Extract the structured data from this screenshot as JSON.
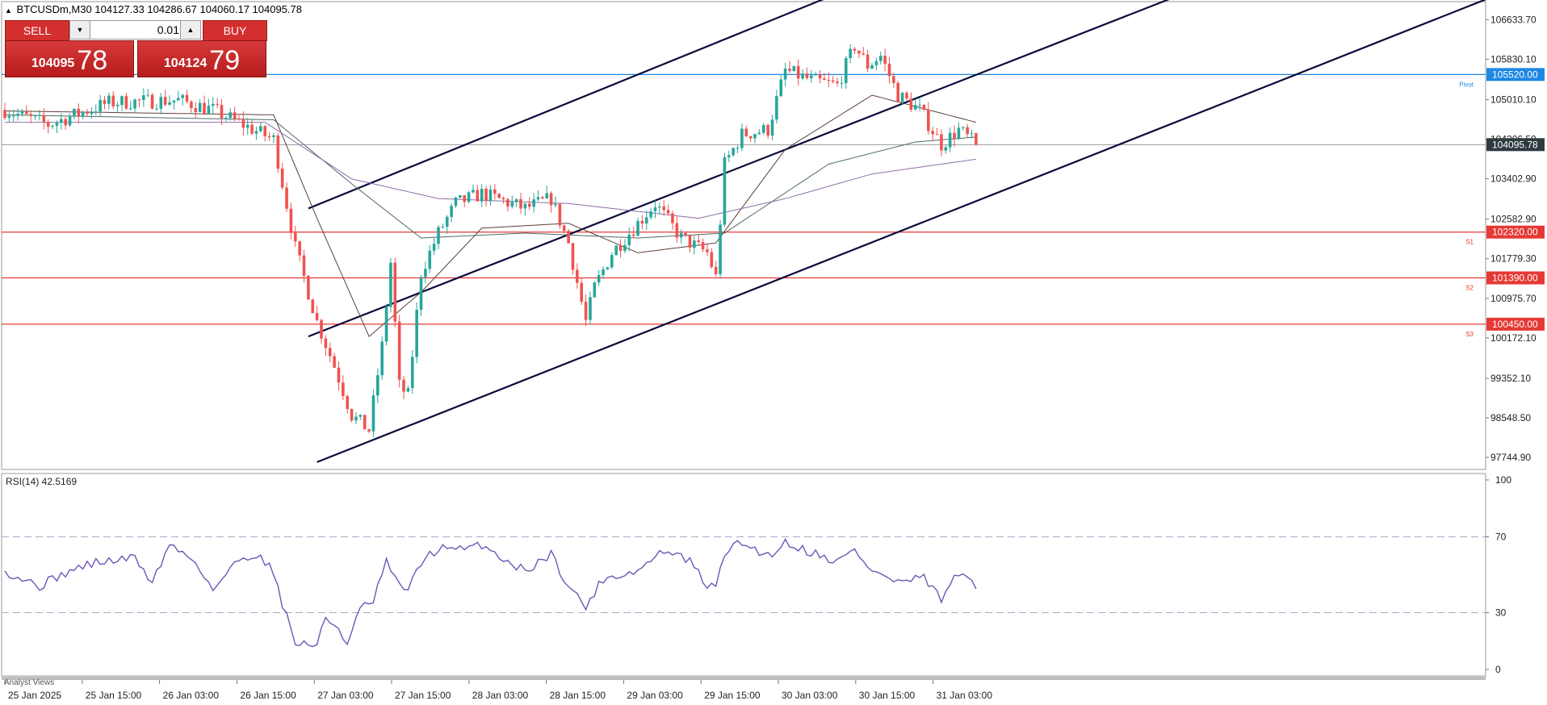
{
  "header": {
    "symbol_title": "BTCUSDm,M30",
    "ohlc": "104127.33 104286.67 104060.17 104095.78"
  },
  "trade_panel": {
    "sell_label": "SELL",
    "buy_label": "BUY",
    "lot_value": "0.01",
    "sell_price_main": "104095",
    "sell_price_big": "78",
    "buy_price_main": "104124",
    "buy_price_big": "79"
  },
  "bottom_tab": "Analyst Views",
  "colors": {
    "bull": "#26a69a",
    "bear": "#ef5350",
    "channel": "#0a0a3c",
    "pivot": "#1e88e5",
    "support": "#e53935",
    "rsi": "#6f55b5",
    "ma1": "#5d4037",
    "ma2": "#4f6b66",
    "ma3": "#8e6fa8"
  },
  "chart_data": [
    {
      "type": "candlestick",
      "series_name": "BTCUSDm,M30",
      "ylim": [
        97500,
        107000
      ],
      "y_ticks": [
        "106633.70",
        "105830.10",
        "105010.10",
        "104206.50",
        "103402.90",
        "102582.90",
        "101779.30",
        "100975.70",
        "100172.10",
        "99352.10",
        "98548.50",
        "97744.90"
      ],
      "x_ticks": [
        "25 Jan 2025",
        "25 Jan 15:00",
        "26 Jan 03:00",
        "26 Jan 15:00",
        "27 Jan 03:00",
        "27 Jan 15:00",
        "28 Jan 03:00",
        "28 Jan 15:00",
        "29 Jan 03:00",
        "29 Jan 15:00",
        "30 Jan 03:00",
        "30 Jan 15:00",
        "31 Jan 03:00"
      ],
      "price_anchors": [
        {
          "t": 0,
          "p": 104800
        },
        {
          "t": 10,
          "p": 104500
        },
        {
          "t": 24,
          "p": 104950
        },
        {
          "t": 40,
          "p": 105000
        },
        {
          "t": 48,
          "p": 104800
        },
        {
          "t": 55,
          "p": 104500
        },
        {
          "t": 62,
          "p": 104200
        },
        {
          "t": 67,
          "p": 102000
        },
        {
          "t": 72,
          "p": 100500
        },
        {
          "t": 76,
          "p": 99600
        },
        {
          "t": 80,
          "p": 98600
        },
        {
          "t": 84,
          "p": 98300
        },
        {
          "t": 87,
          "p": 100000
        },
        {
          "t": 89,
          "p": 101700
        },
        {
          "t": 91,
          "p": 99200
        },
        {
          "t": 93,
          "p": 99000
        },
        {
          "t": 96,
          "p": 101500
        },
        {
          "t": 100,
          "p": 102300
        },
        {
          "t": 104,
          "p": 102900
        },
        {
          "t": 110,
          "p": 103100
        },
        {
          "t": 120,
          "p": 102800
        },
        {
          "t": 126,
          "p": 103000
        },
        {
          "t": 130,
          "p": 102100
        },
        {
          "t": 134,
          "p": 100500
        },
        {
          "t": 136,
          "p": 101200
        },
        {
          "t": 140,
          "p": 101900
        },
        {
          "t": 146,
          "p": 102500
        },
        {
          "t": 150,
          "p": 102900
        },
        {
          "t": 156,
          "p": 102200
        },
        {
          "t": 162,
          "p": 101900
        },
        {
          "t": 164,
          "p": 101400
        },
        {
          "t": 166,
          "p": 103700
        },
        {
          "t": 170,
          "p": 104300
        },
        {
          "t": 176,
          "p": 104400
        },
        {
          "t": 180,
          "p": 105600
        },
        {
          "t": 186,
          "p": 105400
        },
        {
          "t": 192,
          "p": 105300
        },
        {
          "t": 196,
          "p": 106100
        },
        {
          "t": 199,
          "p": 105700
        },
        {
          "t": 202,
          "p": 105900
        },
        {
          "t": 206,
          "p": 105100
        },
        {
          "t": 211,
          "p": 104800
        },
        {
          "t": 216,
          "p": 104100
        },
        {
          "t": 220,
          "p": 104400
        },
        {
          "t": 224,
          "p": 104095
        }
      ],
      "candle_count": 225,
      "moving_averages": [
        {
          "anchors": [
            {
              "t": 0,
              "p": 104780
            },
            {
              "t": 62,
              "p": 104700
            },
            {
              "t": 72,
              "p": 102600
            },
            {
              "t": 84,
              "p": 100200
            },
            {
              "t": 96,
              "p": 101100
            },
            {
              "t": 110,
              "p": 102400
            },
            {
              "t": 130,
              "p": 102500
            },
            {
              "t": 146,
              "p": 101900
            },
            {
              "t": 164,
              "p": 102100
            },
            {
              "t": 180,
              "p": 104000
            },
            {
              "t": 200,
              "p": 105100
            },
            {
              "t": 224,
              "p": 104550
            }
          ]
        },
        {
          "anchors": [
            {
              "t": 0,
              "p": 104700
            },
            {
              "t": 62,
              "p": 104600
            },
            {
              "t": 80,
              "p": 103300
            },
            {
              "t": 96,
              "p": 102200
            },
            {
              "t": 120,
              "p": 102300
            },
            {
              "t": 146,
              "p": 102200
            },
            {
              "t": 166,
              "p": 102300
            },
            {
              "t": 190,
              "p": 103700
            },
            {
              "t": 210,
              "p": 104150
            },
            {
              "t": 224,
              "p": 104250
            }
          ]
        },
        {
          "anchors": [
            {
              "t": 0,
              "p": 104550
            },
            {
              "t": 60,
              "p": 104550
            },
            {
              "t": 80,
              "p": 103400
            },
            {
              "t": 100,
              "p": 103000
            },
            {
              "t": 130,
              "p": 102900
            },
            {
              "t": 160,
              "p": 102600
            },
            {
              "t": 180,
              "p": 103000
            },
            {
              "t": 200,
              "p": 103500
            },
            {
              "t": 224,
              "p": 103800
            }
          ]
        }
      ],
      "channel_lines": [
        {
          "start": {
            "t": 70,
            "p": 102800
          },
          "end": {
            "t": 193,
            "p": 107200
          }
        },
        {
          "start": {
            "t": 70,
            "p": 100200
          },
          "end": {
            "t": 270,
            "p": 107100
          }
        },
        {
          "start": {
            "t": 72,
            "p": 97650
          },
          "end": {
            "t": 346,
            "p": 107200
          }
        }
      ],
      "levels": [
        {
          "label": "Pivot",
          "price": 105520,
          "price_label": "105520.00",
          "color": "#1e88e5"
        },
        {
          "label": "S1",
          "price": 102320,
          "price_label": "102320.00",
          "color": "#e53935"
        },
        {
          "label": "S2",
          "price": 101390,
          "price_label": "101390.00",
          "color": "#e53935"
        },
        {
          "label": "S3",
          "price": 100450,
          "price_label": "100450.00",
          "color": "#e53935"
        }
      ],
      "current_price": 104095.78,
      "current_price_label": "104095.78"
    },
    {
      "type": "line",
      "title": "RSI(14) 42.5169",
      "ylim": [
        0,
        100
      ],
      "y_ticks": [
        100,
        70,
        30,
        0
      ],
      "levels": [
        70,
        30
      ],
      "anchors": [
        {
          "t": 0,
          "p": 52
        },
        {
          "t": 8,
          "p": 44
        },
        {
          "t": 14,
          "p": 51
        },
        {
          "t": 20,
          "p": 56
        },
        {
          "t": 30,
          "p": 59
        },
        {
          "t": 34,
          "p": 46
        },
        {
          "t": 38,
          "p": 66
        },
        {
          "t": 44,
          "p": 57
        },
        {
          "t": 48,
          "p": 42
        },
        {
          "t": 54,
          "p": 58
        },
        {
          "t": 58,
          "p": 61
        },
        {
          "t": 62,
          "p": 52
        },
        {
          "t": 64,
          "p": 35
        },
        {
          "t": 67,
          "p": 14
        },
        {
          "t": 72,
          "p": 13
        },
        {
          "t": 74,
          "p": 27
        },
        {
          "t": 77,
          "p": 22
        },
        {
          "t": 79,
          "p": 13
        },
        {
          "t": 82,
          "p": 32
        },
        {
          "t": 85,
          "p": 36
        },
        {
          "t": 88,
          "p": 57
        },
        {
          "t": 90,
          "p": 47
        },
        {
          "t": 93,
          "p": 42
        },
        {
          "t": 97,
          "p": 60
        },
        {
          "t": 101,
          "p": 64
        },
        {
          "t": 106,
          "p": 63
        },
        {
          "t": 110,
          "p": 66
        },
        {
          "t": 116,
          "p": 57
        },
        {
          "t": 120,
          "p": 52
        },
        {
          "t": 126,
          "p": 61
        },
        {
          "t": 130,
          "p": 44
        },
        {
          "t": 134,
          "p": 33
        },
        {
          "t": 138,
          "p": 48
        },
        {
          "t": 146,
          "p": 52
        },
        {
          "t": 152,
          "p": 63
        },
        {
          "t": 158,
          "p": 57
        },
        {
          "t": 162,
          "p": 44
        },
        {
          "t": 164,
          "p": 43
        },
        {
          "t": 166,
          "p": 62
        },
        {
          "t": 170,
          "p": 67
        },
        {
          "t": 176,
          "p": 60
        },
        {
          "t": 180,
          "p": 67
        },
        {
          "t": 186,
          "p": 62
        },
        {
          "t": 192,
          "p": 57
        },
        {
          "t": 196,
          "p": 63
        },
        {
          "t": 200,
          "p": 52
        },
        {
          "t": 206,
          "p": 46
        },
        {
          "t": 212,
          "p": 48
        },
        {
          "t": 216,
          "p": 37
        },
        {
          "t": 220,
          "p": 51
        },
        {
          "t": 224,
          "p": 42.5
        }
      ]
    }
  ]
}
